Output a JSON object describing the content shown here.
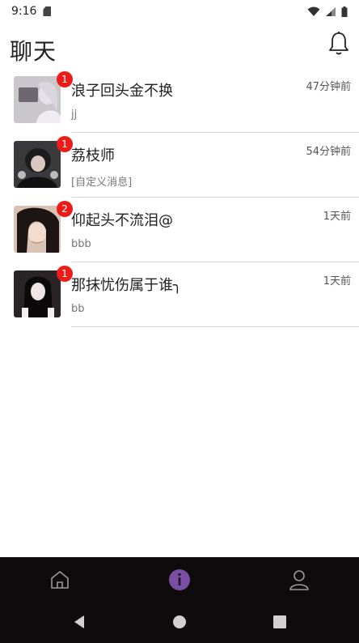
{
  "status_bar": {
    "time": "9:16"
  },
  "header": {
    "title": "聊天"
  },
  "chats": [
    {
      "name": "浪子回头金不换",
      "time": "47分钟前",
      "preview": "jj",
      "unread": "1"
    },
    {
      "name": "荔枝师",
      "time": "54分钟前",
      "preview": "[自定义消息]",
      "unread": "1"
    },
    {
      "name": "仰起头不流泪@",
      "time": "1天前",
      "preview": "bbb",
      "unread": "2"
    },
    {
      "name": "那抹忧伤属于谁╮",
      "time": "1天前",
      "preview": "bb",
      "unread": "1"
    }
  ],
  "bottom_nav": {
    "items": [
      {
        "icon": "home-icon",
        "active": false
      },
      {
        "icon": "info-icon",
        "active": true
      },
      {
        "icon": "person-icon",
        "active": false
      }
    ],
    "accent": "#7a4fa3"
  },
  "colors": {
    "badge": "#ee1b1b",
    "nav_bg": "#0d0b0c"
  }
}
